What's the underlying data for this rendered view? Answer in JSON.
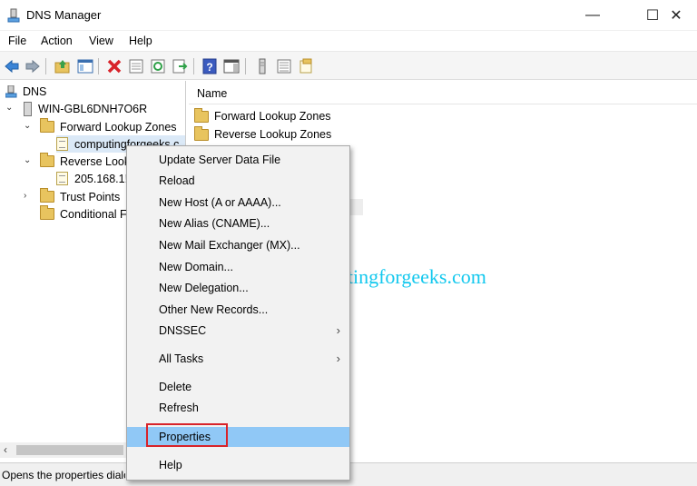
{
  "window": {
    "title": "DNS Manager",
    "minimize": "—",
    "maximize": "☐",
    "close": "✕"
  },
  "menu": [
    "File",
    "Action",
    "View",
    "Help"
  ],
  "tree": {
    "root": "DNS",
    "server": "WIN-GBL6DNH7O6R",
    "forward": "Forward Lookup Zones",
    "forward_zone": "computingforgeeks.c",
    "reverse": "Reverse Look",
    "reverse_zone": "205.168.1!",
    "trust": "Trust Points",
    "conditional": "Conditional F"
  },
  "list": {
    "column_name": "Name",
    "rows": [
      "Forward Lookup Zones",
      "Reverse Lookup Zones"
    ]
  },
  "context_menu": {
    "items": [
      "Update Server Data File",
      "Reload",
      "New Host (A or AAAA)...",
      "New Alias (CNAME)...",
      "New Mail Exchanger (MX)...",
      "New Domain...",
      "New Delegation...",
      "Other New Records...",
      "DNSSEC",
      "All Tasks",
      "Delete",
      "Refresh",
      "Properties",
      "Help"
    ],
    "highlighted": "Properties",
    "highlight_color": "#90c8f6",
    "callout_color": "#d8232a"
  },
  "watermark": "computingforgeeks.com",
  "status": "Opens the properties dialog"
}
